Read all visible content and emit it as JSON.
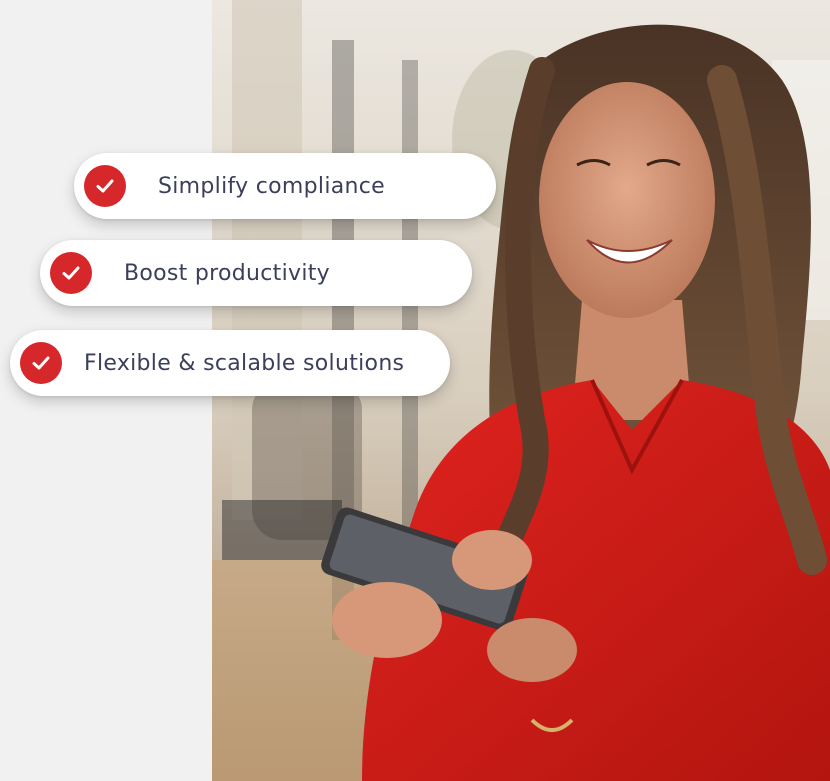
{
  "benefits": [
    {
      "label": "Simplify compliance",
      "icon": "check-circle-icon"
    },
    {
      "label": "Boost productivity",
      "icon": "check-circle-icon"
    },
    {
      "label": "Flexible & scalable solutions",
      "icon": "check-circle-icon"
    }
  ],
  "colors": {
    "accent": "#d6272b",
    "text": "#3b3f5c",
    "panel": "#f1f1f2"
  }
}
